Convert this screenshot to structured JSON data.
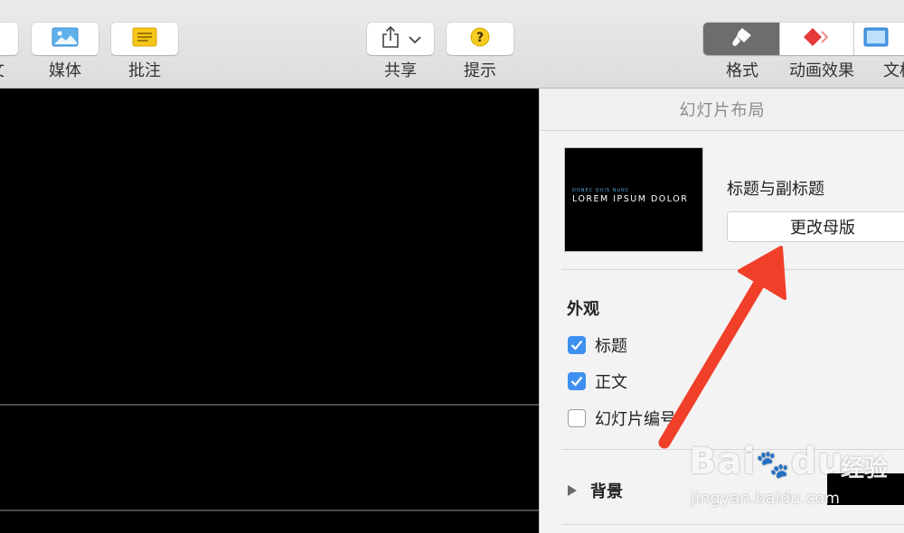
{
  "toolbar": {
    "left_partial_label": "文",
    "media_label": "媒体",
    "comment_label": "批注",
    "share_label": "共享",
    "tips_label": "提示",
    "format_label": "格式",
    "animate_label": "动画效果",
    "document_label": "文档"
  },
  "inspector": {
    "header": "幻灯片布局",
    "thumbnail": {
      "small_text": "DONEC QUIS NUNC",
      "title_text": "LOREM IPSUM DOLOR"
    },
    "master_name": "标题与副标题",
    "change_master_label": "更改母版",
    "appearance": {
      "title": "外观",
      "options": [
        {
          "label": "标题",
          "checked": true
        },
        {
          "label": "正文",
          "checked": true
        },
        {
          "label": "幻灯片编号",
          "checked": false
        }
      ]
    },
    "background_label": "背景"
  },
  "watermark": {
    "brand": "Bai",
    "brand2": "du",
    "jingyan": "经验",
    "url": "jingyan.baidu.com"
  },
  "colors": {
    "checkbox_blue": "#3f8ff0",
    "annotation_red": "#f0402a",
    "active_segment": "#6d6d6d"
  }
}
